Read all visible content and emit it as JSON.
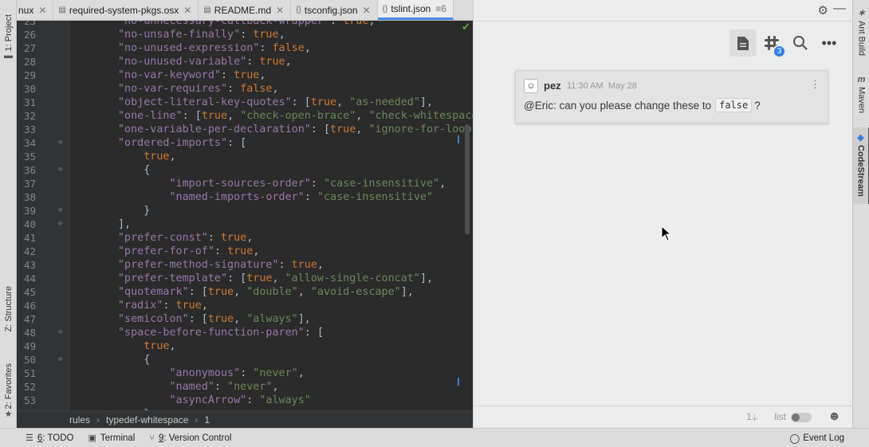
{
  "left_tool_windows": [
    {
      "label": "1: Project",
      "icon": "folder-icon"
    },
    {
      "label": "Z: Structure",
      "icon": "structure-icon"
    },
    {
      "label": "2: Favorites",
      "icon": "star-icon"
    }
  ],
  "tabs": [
    {
      "label": "nux",
      "icon": "",
      "active": false
    },
    {
      "label": "required-system-pkgs.osx",
      "icon": "file-icon",
      "active": false
    },
    {
      "label": "README.md",
      "icon": "markdown-icon",
      "active": false
    },
    {
      "label": "tsconfig.json",
      "icon": "json-icon",
      "active": false
    },
    {
      "label": "tslint.json",
      "icon": "json-icon",
      "active": true,
      "extra": "≡6"
    }
  ],
  "editor": {
    "lines": [
      {
        "n": "25",
        "html": "<span class=\"k\">\"no-unnecessary-callback-wrapper\"</span>: <span class=\"b\">true</span>,"
      },
      {
        "n": "26",
        "html": "<span class=\"k\">\"no-unsafe-finally\"</span>: <span class=\"b\">true</span>,"
      },
      {
        "n": "27",
        "html": "<span class=\"k\">\"no-unused-expression\"</span>: <span class=\"b\">false</span>,"
      },
      {
        "n": "28",
        "html": "<span class=\"k\">\"no-unused-variable\"</span>: <span class=\"b\">true</span>,"
      },
      {
        "n": "29",
        "html": "<span class=\"k\">\"no-var-keyword\"</span>: <span class=\"b\">true</span>,"
      },
      {
        "n": "30",
        "html": "<span class=\"k\">\"no-var-requires\"</span>: <span class=\"b\">false</span>,"
      },
      {
        "n": "31",
        "html": "<span class=\"k\">\"object-literal-key-quotes\"</span>: [<span class=\"b\">true</span>, <span class=\"s\">\"as-needed\"</span>],"
      },
      {
        "n": "32",
        "html": "<span class=\"k\">\"one-line\"</span>: [<span class=\"b\">true</span>, <span class=\"s\">\"check-open-brace\"</span>, <span class=\"s\">\"check-whitespace</span>"
      },
      {
        "n": "33",
        "html": "<span class=\"k\">\"one-variable-per-declaration\"</span>: [<span class=\"b\">true</span>, <span class=\"s\">\"ignore-for-loop\"</span>"
      },
      {
        "n": "34",
        "html": "<span class=\"k\">\"ordered-imports\"</span>: [",
        "fold": true
      },
      {
        "n": "35",
        "html": "    <span class=\"b\">true</span>,"
      },
      {
        "n": "36",
        "html": "    {",
        "fold": true
      },
      {
        "n": "37",
        "html": "        <span class=\"k\">\"import-sources-order\"</span>: <span class=\"s\">\"case-insensitive\"</span>,"
      },
      {
        "n": "38",
        "html": "        <span class=\"k\">\"named-imports-order\"</span>: <span class=\"s\">\"case-insensitive\"</span>"
      },
      {
        "n": "39",
        "html": "    }",
        "fold": true
      },
      {
        "n": "40",
        "html": "],",
        "fold": true
      },
      {
        "n": "41",
        "html": "<span class=\"k\">\"prefer-const\"</span>: <span class=\"b\">true</span>,"
      },
      {
        "n": "42",
        "html": "<span class=\"k\">\"prefer-for-of\"</span>: <span class=\"b\">true</span>,"
      },
      {
        "n": "43",
        "html": "<span class=\"k\">\"prefer-method-signature\"</span>: <span class=\"b\">true</span>,"
      },
      {
        "n": "44",
        "html": "<span class=\"k\">\"prefer-template\"</span>: [<span class=\"b\">true</span>, <span class=\"s\">\"allow-single-concat\"</span>],"
      },
      {
        "n": "45",
        "html": "<span class=\"k\">\"quotemark\"</span>: [<span class=\"b\">true</span>, <span class=\"s\">\"double\"</span>, <span class=\"s\">\"avoid-escape\"</span>],"
      },
      {
        "n": "46",
        "html": "<span class=\"k\">\"radix\"</span>: <span class=\"b\">true</span>,"
      },
      {
        "n": "47",
        "html": "<span class=\"k\">\"semicolon\"</span>: [<span class=\"b\">true</span>, <span class=\"s\">\"always\"</span>],"
      },
      {
        "n": "48",
        "html": "<span class=\"k\">\"space-before-function-paren\"</span>: [",
        "fold": true
      },
      {
        "n": "49",
        "html": "    <span class=\"b\">true</span>,"
      },
      {
        "n": "50",
        "html": "    {",
        "fold": true
      },
      {
        "n": "51",
        "html": "        <span class=\"k\">\"anonymous\"</span>: <span class=\"s\">\"never\"</span>,"
      },
      {
        "n": "52",
        "html": "        <span class=\"k\">\"named\"</span>: <span class=\"s\">\"never\"</span>,"
      },
      {
        "n": "53",
        "html": "        <span class=\"k\">\"asyncArrow\"</span>: <span class=\"s\">\"always\"</span>"
      },
      {
        "n": "54",
        "html": "    }"
      }
    ]
  },
  "breadcrumb": [
    "rules",
    "typedef-whitespace",
    "1"
  ],
  "statusbar": {
    "todo": {
      "num": "6",
      "rest": ": TODO"
    },
    "terminal": "Terminal",
    "vcs": {
      "num": "9",
      "rest": ": Version Control"
    },
    "event_log": "Event Log"
  },
  "codestream": {
    "message": {
      "author": "pez",
      "time": "11:30 AM",
      "date": "May 28",
      "text": "@Eric: can you please change these to",
      "code": "false",
      "suffix": "?"
    },
    "badge_count": "3",
    "footer": {
      "unread": "1",
      "list_label": "list"
    }
  },
  "right_tool_windows": [
    {
      "label": "Ant Build",
      "icon": "ant-icon"
    },
    {
      "label": "Maven",
      "icon": "maven-icon",
      "glyph": "m"
    },
    {
      "label": "CodeStream",
      "icon": "codestream-icon",
      "glyph": "◈",
      "active": true
    }
  ],
  "colors": {
    "editor_bg": "#2b2b2b",
    "key": "#9876aa",
    "string": "#6a8759",
    "keyword": "#cc7832",
    "accent": "#4a88e8",
    "badge": "#2f7de0"
  }
}
